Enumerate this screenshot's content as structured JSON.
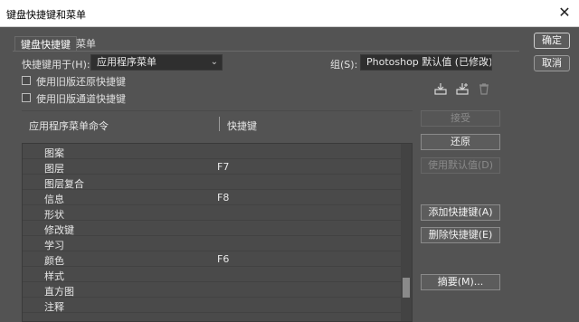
{
  "window": {
    "title": "键盘快捷键和菜单"
  },
  "tabs": [
    {
      "label": "键盘快捷键",
      "active": true
    },
    {
      "label": "菜单",
      "active": false
    }
  ],
  "shortcuts_for": {
    "label": "快捷键用于(H):",
    "value": "应用程序菜单"
  },
  "set": {
    "label": "组(S):",
    "value": "Photoshop 默认值 (已修改)"
  },
  "options": [
    {
      "label": "使用旧版还原快捷键",
      "checked": false
    },
    {
      "label": "使用旧版通道快捷键",
      "checked": false
    }
  ],
  "columns": {
    "command": "应用程序菜单命令",
    "shortcut": "快捷键"
  },
  "rows": [
    {
      "name": "图案",
      "key": ""
    },
    {
      "name": "图层",
      "key": "F7"
    },
    {
      "name": "图层复合",
      "key": ""
    },
    {
      "name": "信息",
      "key": "F8"
    },
    {
      "name": "形状",
      "key": ""
    },
    {
      "name": "修改键",
      "key": ""
    },
    {
      "name": "学习",
      "key": ""
    },
    {
      "name": "颜色",
      "key": "F6"
    },
    {
      "name": "样式",
      "key": ""
    },
    {
      "name": "直方图",
      "key": ""
    },
    {
      "name": "注释",
      "key": ""
    }
  ],
  "buttons": {
    "accept": "接受",
    "undo": "还原",
    "use_default": "使用默认值(D)",
    "add_shortcut": "添加快捷键(A)",
    "delete_shortcut": "删除快捷键(E)",
    "summarize": "摘要(M)..."
  },
  "dialog": {
    "ok": "确定",
    "cancel": "取消"
  },
  "icons": [
    "save-set-icon",
    "new-set-icon",
    "delete-set-icon",
    "close-icon",
    "chevron-down-icon"
  ]
}
